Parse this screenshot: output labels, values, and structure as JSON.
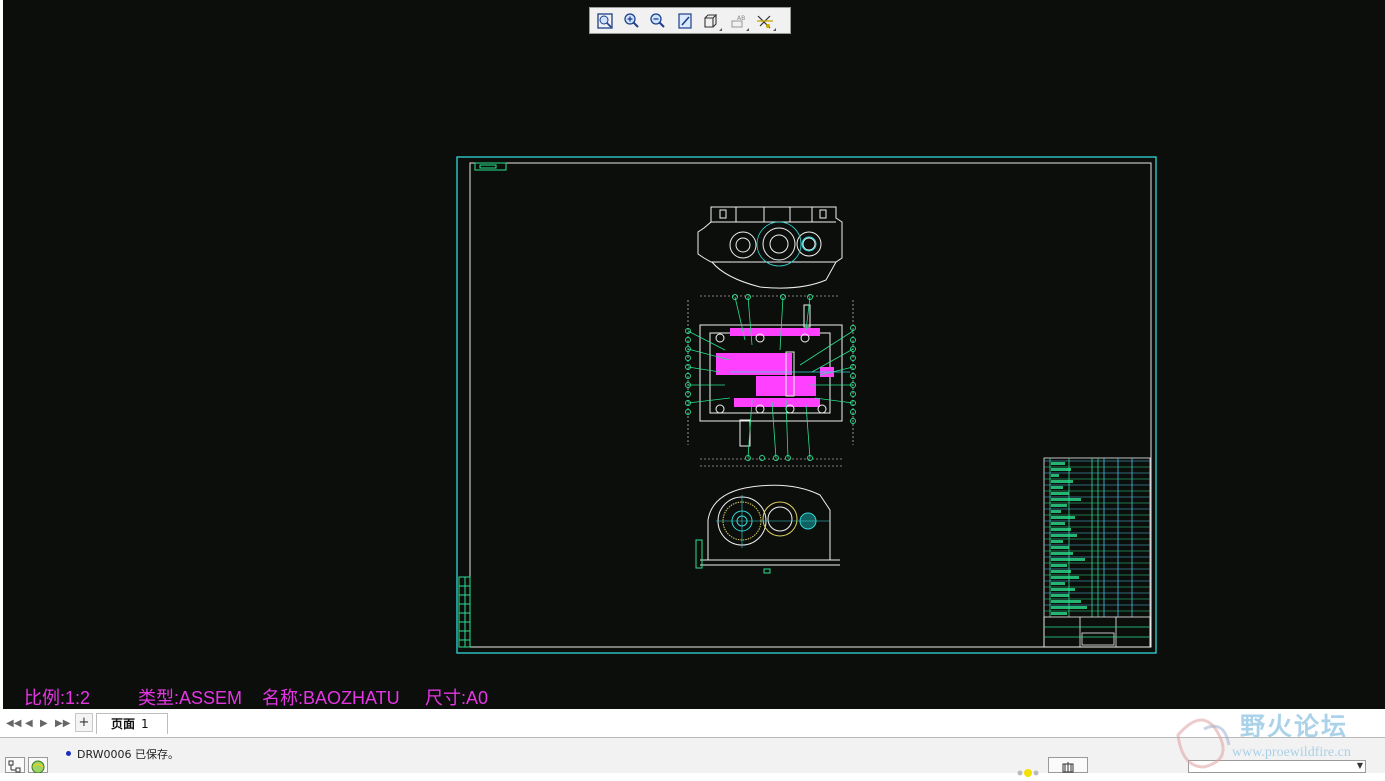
{
  "toolbar": {
    "icons": [
      "refit-icon",
      "zoom-in-icon",
      "zoom-out-icon",
      "repaint-icon",
      "view-orient-icon",
      "annotation-display-icon",
      "datum-display-icon"
    ]
  },
  "drawing_info": {
    "scale": "比例:1:2",
    "type": "类型:ASSEM",
    "name": "名称:BAOZHATU",
    "size": "尺寸:A0"
  },
  "tabs": {
    "add_label": "+",
    "page_label": "页面",
    "page_number": "1"
  },
  "status": {
    "message": "DRW0006 已保存。"
  },
  "watermark": {
    "title": "野火论坛",
    "url": "www.proewildfire.cn"
  },
  "colors": {
    "canvas_bg": "#0c0e0c",
    "frame": "#33d6d6",
    "text_magenta": "#e535e5",
    "highlight_magenta": "#ff40ff",
    "leader_green": "#2ae08c"
  }
}
